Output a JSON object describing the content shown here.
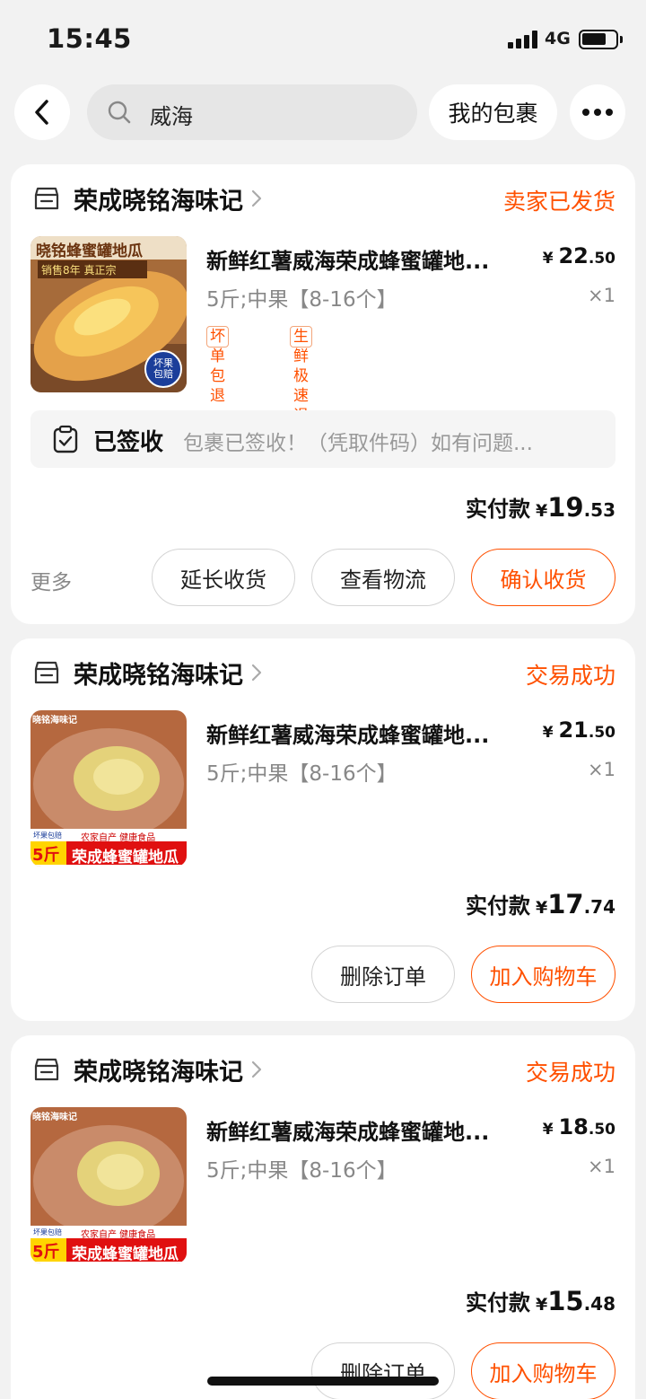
{
  "status_bar": {
    "time": "15:45",
    "network": "4G"
  },
  "header": {
    "search_text": "威海",
    "parcel_button": "我的包裹"
  },
  "orders": [
    {
      "shop": "荣成晓铭海味记",
      "status": "卖家已发货",
      "title": "新鲜红薯威海荣成蜂蜜罐地...",
      "sku": "5斤;中果【8-16个】",
      "price_int": "22",
      "price_dec": ".50",
      "qty": "×1",
      "tags": [
        "坏单包退",
        "生鲜极速退"
      ],
      "image_text": {
        "banner": "晓铭蜂蜜罐地瓜",
        "sub": "销售8年 真正宗",
        "badge": "坏果包赔"
      },
      "tracking": {
        "title": "已签收",
        "desc": "包裹已签收！（凭取件码）如有问题..."
      },
      "total_label": "实付款",
      "currency": "¥",
      "total_int": "19",
      "total_dec": ".53",
      "more": "更多",
      "buttons": [
        "延长收货",
        "查看物流",
        "确认收货"
      ]
    },
    {
      "shop": "荣成晓铭海味记",
      "status": "交易成功",
      "title": "新鲜红薯威海荣成蜂蜜罐地...",
      "sku": "5斤;中果【8-16个】",
      "price_int": "21",
      "price_dec": ".50",
      "qty": "×1",
      "image_text": {
        "corner": "晓铭海味记",
        "weight": "5斤",
        "small_tag": "坏果包赔",
        "slogan": "农家自产 健康食品",
        "banner": "荣成蜂蜜罐地瓜"
      },
      "total_label": "实付款",
      "currency": "¥",
      "total_int": "17",
      "total_dec": ".74",
      "buttons": [
        "删除订单",
        "加入购物车"
      ]
    },
    {
      "shop": "荣成晓铭海味记",
      "status": "交易成功",
      "title": "新鲜红薯威海荣成蜂蜜罐地...",
      "sku": "5斤;中果【8-16个】",
      "price_int": "18",
      "price_dec": ".50",
      "qty": "×1",
      "image_text": {
        "corner": "晓铭海味记",
        "weight": "5斤",
        "small_tag": "坏果包赔",
        "slogan": "农家自产 健康食品",
        "banner": "荣成蜂蜜罐地瓜"
      },
      "total_label": "实付款",
      "currency": "¥",
      "total_int": "15",
      "total_dec": ".48",
      "buttons": [
        "删除订单",
        "加入购物车"
      ]
    }
  ],
  "colors": {
    "accent": "#ff5000",
    "background": "#f2f2f2",
    "card": "#ffffff"
  }
}
